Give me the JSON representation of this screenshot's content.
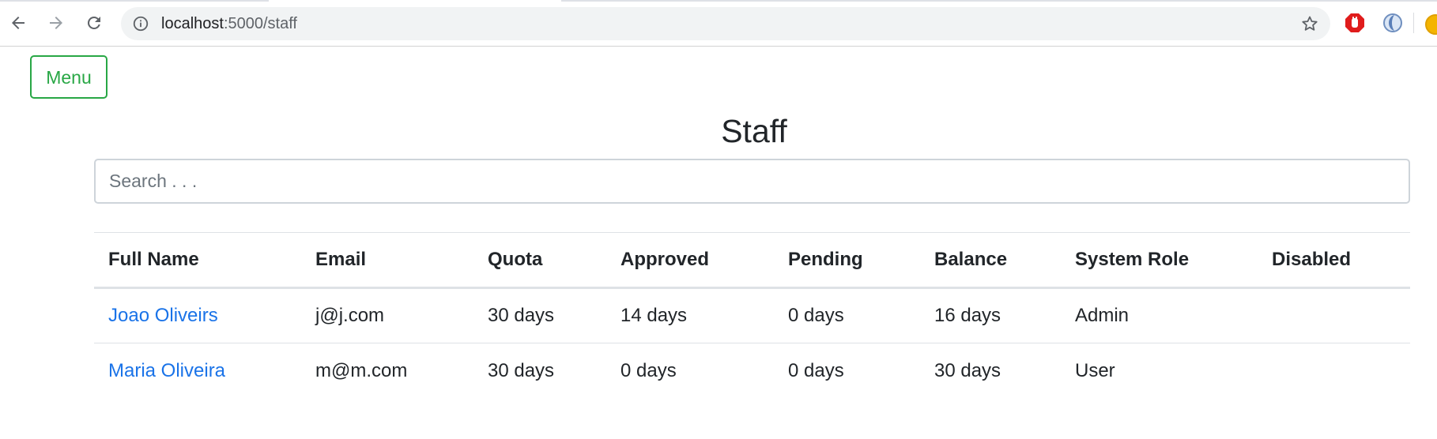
{
  "browser": {
    "url_host": "localhost",
    "url_rest": ":5000/staff",
    "icons": {
      "back": "back-arrow-icon",
      "forward": "forward-arrow-icon",
      "reload": "reload-icon",
      "info": "info-icon",
      "star": "star-icon",
      "ext1": "stop-hand-extension-icon",
      "ext2": "globe-extension-icon"
    }
  },
  "page": {
    "menu_label": "Menu",
    "title": "Staff",
    "search_placeholder": "Search . . ."
  },
  "table": {
    "headers": [
      "Full Name",
      "Email",
      "Quota",
      "Approved",
      "Pending",
      "Balance",
      "System Role",
      "Disabled"
    ],
    "rows": [
      {
        "name": "Joao Oliveirs",
        "email": "j@j.com",
        "quota": "30 days",
        "approved": "14 days",
        "pending": "0 days",
        "balance": "16 days",
        "role": "Admin",
        "disabled": ""
      },
      {
        "name": "Maria Oliveira",
        "email": "m@m.com",
        "quota": "30 days",
        "approved": "0 days",
        "pending": "0 days",
        "balance": "30 days",
        "role": "User",
        "disabled": ""
      }
    ]
  },
  "colors": {
    "accent_green": "#28a745",
    "link_blue": "#1a73e8",
    "text_dark": "#212529"
  }
}
